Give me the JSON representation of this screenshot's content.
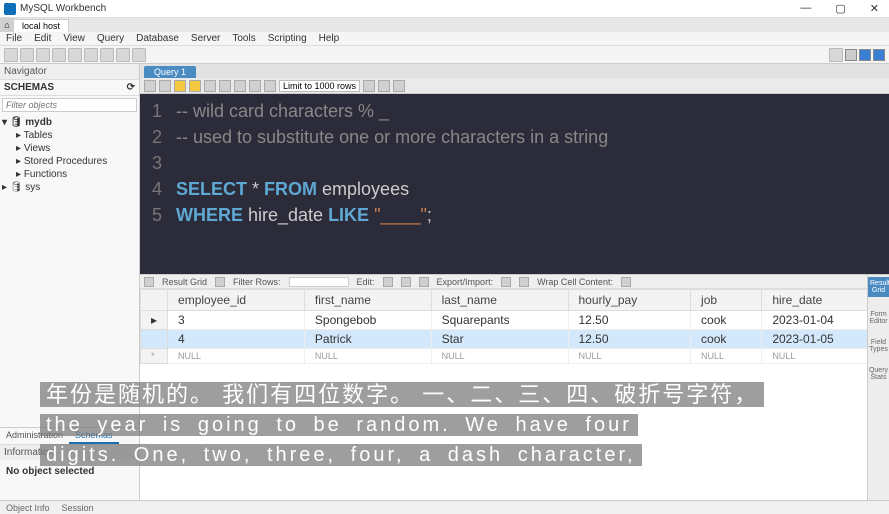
{
  "window": {
    "title": "MySQL Workbench",
    "conn": "local host"
  },
  "menu": [
    "File",
    "Edit",
    "View",
    "Query",
    "Database",
    "Server",
    "Tools",
    "Scripting",
    "Help"
  ],
  "nav": {
    "title": "Navigator",
    "schemas": "SCHEMAS",
    "filter": "Filter objects"
  },
  "tree": {
    "db": "mydb",
    "items": [
      "Tables",
      "Views",
      "Stored Procedures",
      "Functions"
    ],
    "sys": "sys"
  },
  "sidetabs": {
    "a": "Administration",
    "b": "Schemas"
  },
  "info": {
    "hdr": "Information",
    "body": "No object selected"
  },
  "qtab": "Query 1",
  "limit": "Limit to 1000 rows",
  "code": {
    "l1": "-- wild card characters % _",
    "l2": "-- used to substitute one or more characters in a string",
    "l4a": "SELECT",
    "l4b": " * ",
    "l4c": "FROM",
    "l4d": " employees",
    "l5a": "WHERE",
    "l5b": " hire_date ",
    "l5c": "LIKE",
    "l5d": " \"____\"",
    "l5e": ";",
    "ln1": "1",
    "ln2": "2",
    "ln3": "3",
    "ln4": "4",
    "ln5": "5"
  },
  "rtool": {
    "rg": "Result Grid",
    "fr": "Filter Rows:",
    "edit": "Edit:",
    "ei": "Export/Import:",
    "wrap": "Wrap Cell Content:"
  },
  "cols": [
    "employee_id",
    "first_name",
    "last_name",
    "hourly_pay",
    "job",
    "hire_date"
  ],
  "rows": [
    {
      "id": "3",
      "fn": "Spongebob",
      "ln": "Squarepants",
      "hp": "12.50",
      "job": "cook",
      "hd": "2023-01-04"
    },
    {
      "id": "4",
      "fn": "Patrick",
      "ln": "Star",
      "hp": "12.50",
      "job": "cook",
      "hd": "2023-01-05"
    }
  ],
  "null": "NULL",
  "sidep": {
    "a": "Result Grid",
    "b": "Form Editor",
    "c": "Field Types",
    "d": "Query Stats"
  },
  "subs": {
    "cn": "年份是随机的。 我们有四位数字。 一、二、三、四、破折号字符，",
    "en1": "the year is going to be random. We have four",
    "en2": "digits. One, two, three, four, a dash character,"
  },
  "status": {
    "a": "Object Info",
    "b": "Session"
  }
}
